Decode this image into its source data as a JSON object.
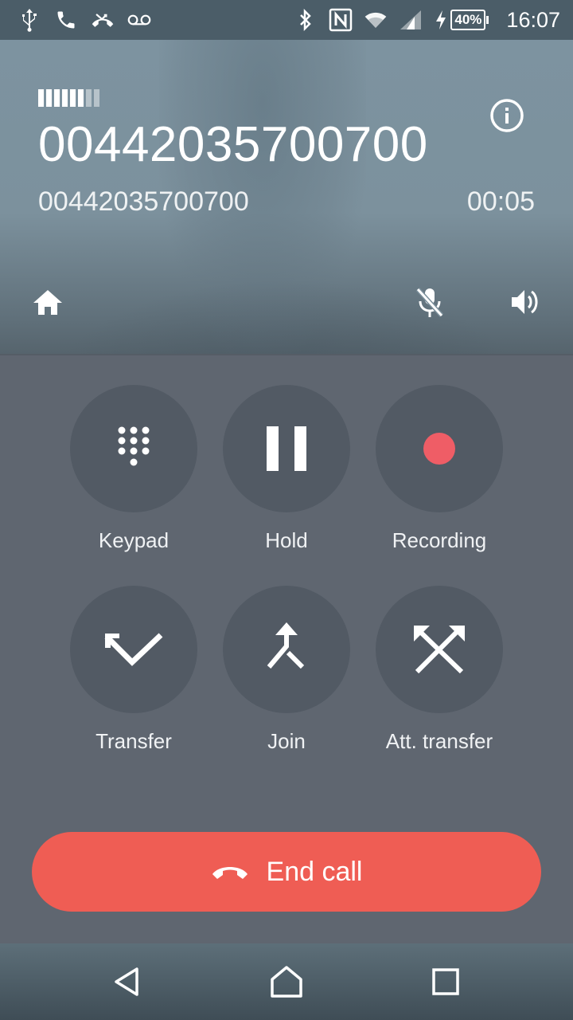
{
  "status_bar": {
    "left_icons": [
      "usb-icon",
      "phone-call-icon",
      "missed-call-icon",
      "voicemail-icon"
    ],
    "right_icons": [
      "bluetooth-icon",
      "nfc-icon",
      "wifi-icon",
      "cell-signal-icon",
      "charging-icon"
    ],
    "battery_percent": "40%",
    "time": "16:07"
  },
  "call": {
    "signal_quality_bars": 8,
    "signal_quality_active": 6,
    "caller_name": "00442035700700",
    "caller_number": "00442035700700",
    "duration": "00:05",
    "info_icon": "info-icon",
    "home_icon": "home-icon",
    "mute_icon": "mic-off-icon",
    "speaker_icon": "speaker-icon"
  },
  "actions": [
    {
      "id": "keypad",
      "label": "Keypad",
      "icon": "dialpad-icon"
    },
    {
      "id": "hold",
      "label": "Hold",
      "icon": "pause-icon"
    },
    {
      "id": "recording",
      "label": "Recording",
      "icon": "record-icon"
    },
    {
      "id": "transfer",
      "label": "Transfer",
      "icon": "transfer-icon"
    },
    {
      "id": "join",
      "label": "Join",
      "icon": "merge-icon"
    },
    {
      "id": "att-transfer",
      "label": "Att. transfer",
      "icon": "attended-transfer-icon"
    }
  ],
  "end_call": {
    "label": "End call",
    "icon": "hang-up-icon"
  },
  "colors": {
    "end_call": "#ef5d54",
    "record_dot": "#ef5d66",
    "panel": "#5f6670",
    "button_circle": "#525a64"
  },
  "navigation": {
    "back_icon": "back-icon",
    "home_icon": "home-outline-icon",
    "recents_icon": "recents-icon"
  }
}
